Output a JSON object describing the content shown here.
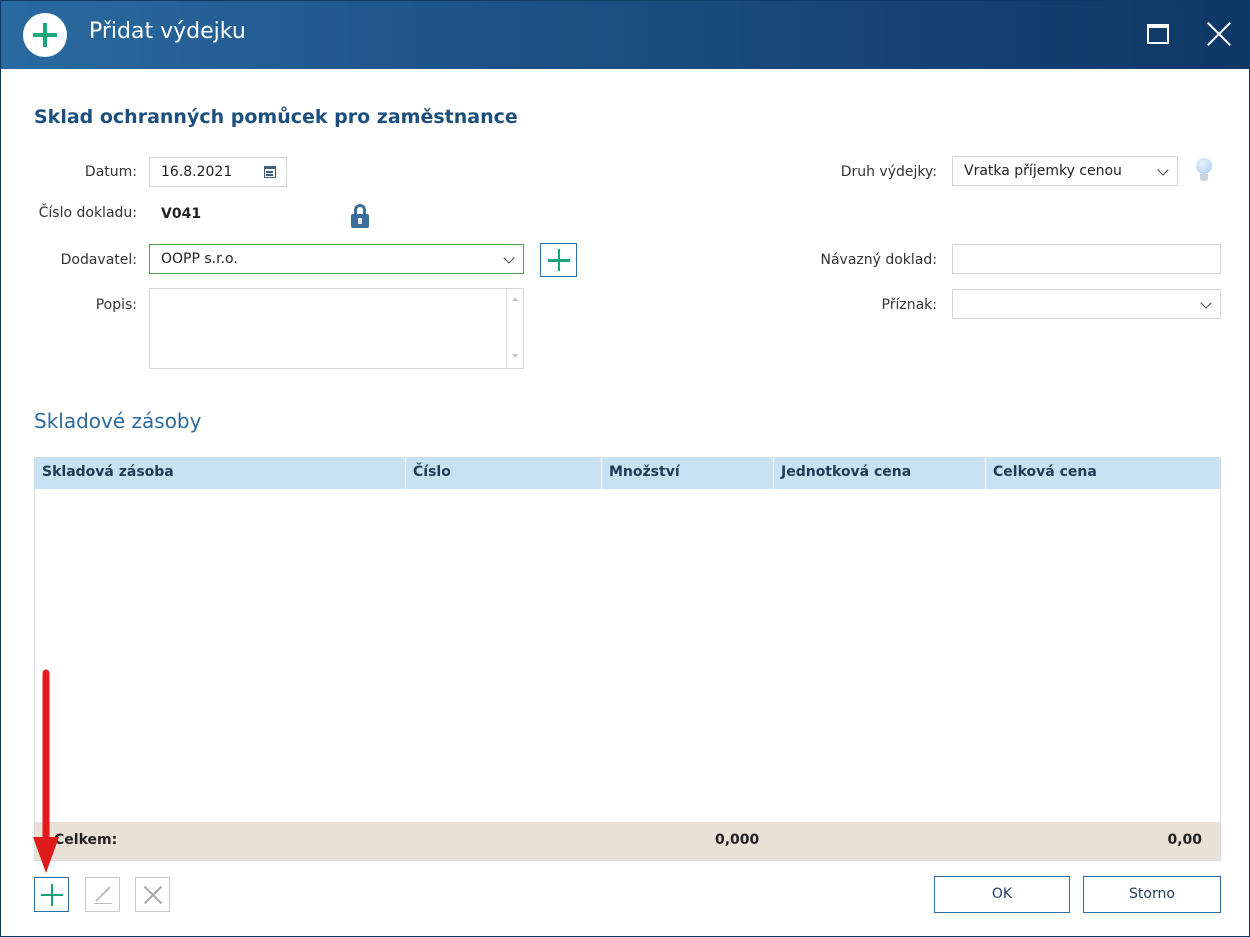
{
  "window": {
    "title": "Přidat výdejku"
  },
  "header": {
    "heading": "Sklad ochranných pomůcek pro zaměstnance"
  },
  "form": {
    "datum_label": "Datum:",
    "datum_value": "16.8.2021",
    "cislo_label": "Číslo dokladu:",
    "cislo_value": "V041",
    "dodavatel_label": "Dodavatel:",
    "dodavatel_value": "OOPP s.r.o.",
    "popis_label": "Popis:",
    "popis_value": "",
    "druh_label": "Druh výdejky:",
    "druh_value": "Vratka příjemky cenou",
    "navazny_label": "Návazný doklad:",
    "navazny_value": "",
    "priznak_label": "Příznak:",
    "priznak_value": ""
  },
  "section": {
    "title": "Skladové zásoby"
  },
  "grid": {
    "columns": [
      "Skladová zásoba",
      "Číslo",
      "Množství",
      "Jednotková cena",
      "Celková cena"
    ],
    "rows": [],
    "footer": {
      "label": "Celkem:",
      "quantity_total": "0,000",
      "price_total": "0,00"
    }
  },
  "buttons": {
    "ok": "OK",
    "cancel": "Storno"
  },
  "colors": {
    "accent_green": "#17a27a",
    "title_bar": "#1d5286",
    "heading_blue": "#1d4f7e",
    "grid_header": "#c6e2f3",
    "grid_footer": "#e9e1d5",
    "annotation_red": "#e01b1b"
  },
  "icons": {
    "title": "plus-circle-icon",
    "maximize": "maximize-icon",
    "close": "close-icon",
    "calendar": "calendar-icon",
    "lock": "lock-icon",
    "hint": "lightbulb-icon",
    "add": "plus-icon",
    "edit": "pencil-icon",
    "delete": "x-icon",
    "annotation": "red-arrow-down-icon"
  }
}
